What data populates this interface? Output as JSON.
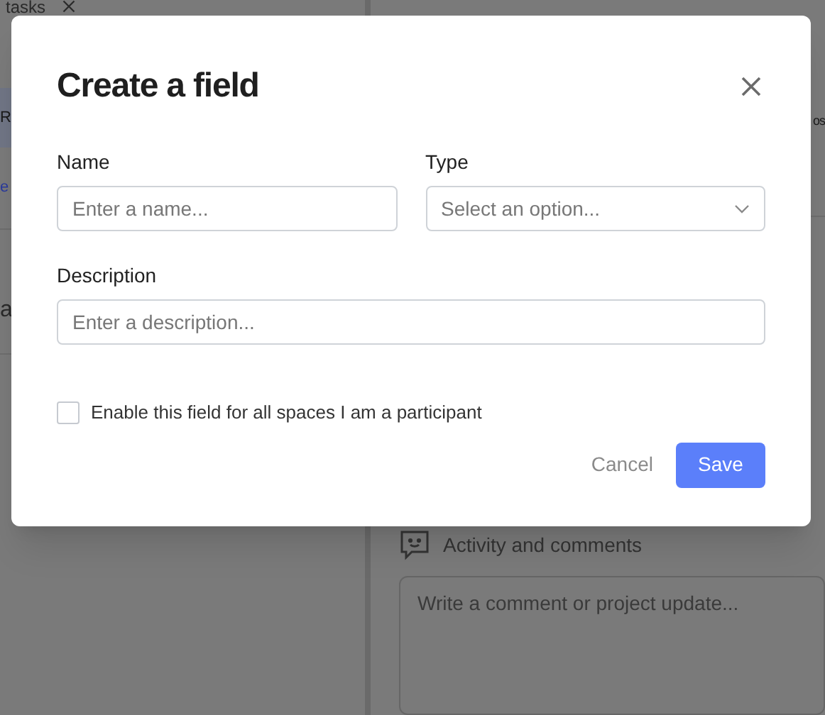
{
  "background": {
    "tab": {
      "label": "tasks"
    },
    "left_rows": [
      {
        "text": "R",
        "kind": "highlight"
      },
      {
        "text": "e",
        "kind": "link"
      },
      {
        "text": "a",
        "kind": "plain"
      }
    ],
    "right_rows": [
      {
        "text": "os"
      }
    ],
    "activity": {
      "title": "Activity and comments",
      "comment_placeholder": "Write a comment or project update..."
    }
  },
  "dialog": {
    "title": "Create a field",
    "fields": [
      {
        "label": "Name",
        "placeholder": "Enter a name...",
        "kind": "text"
      },
      {
        "label": "Type",
        "placeholder": "Select an option...",
        "kind": "select"
      },
      {
        "label": "Description",
        "placeholder": "Enter a description...",
        "kind": "text"
      }
    ],
    "checkbox": {
      "label": "Enable this field for all spaces I am a participant",
      "checked": false
    },
    "buttons": [
      {
        "label": "Cancel",
        "kind": "secondary"
      },
      {
        "label": "Save",
        "kind": "primary"
      }
    ]
  }
}
